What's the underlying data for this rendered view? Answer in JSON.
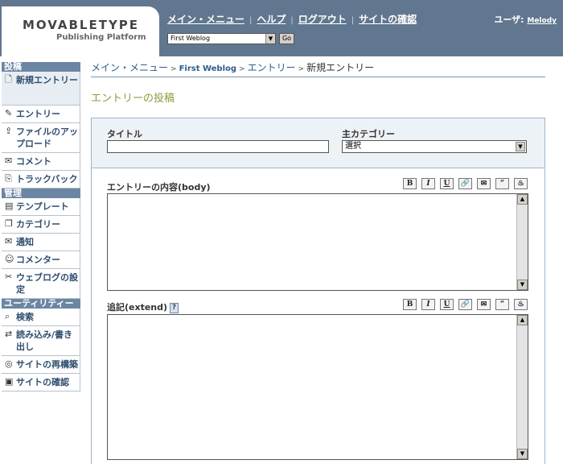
{
  "logo": {
    "title": "MOVABLETYPE",
    "subtitle": "Publishing Platform"
  },
  "topnav": {
    "main_menu": "メイン・メニュー",
    "help": "ヘルプ",
    "logout": "ログアウト",
    "view_site": "サイトの確認"
  },
  "user": {
    "label": "ユーザ:",
    "name": "Melody"
  },
  "blog_selector": {
    "selected": "First Weblog",
    "go_label": "Go"
  },
  "sidebar": {
    "sections": [
      {
        "title": "投稿",
        "items": [
          {
            "label": "新規エントリー",
            "icon": "new-entry-icon"
          },
          {
            "label": "エントリー",
            "icon": "entries-icon"
          },
          {
            "label": "ファイルのアップロード",
            "icon": "upload-icon"
          },
          {
            "label": "コメント",
            "icon": "comment-icon"
          },
          {
            "label": "トラックバック",
            "icon": "trackback-icon"
          }
        ]
      },
      {
        "title": "管理",
        "items": [
          {
            "label": "テンプレート",
            "icon": "template-icon"
          },
          {
            "label": "カテゴリー",
            "icon": "category-icon"
          },
          {
            "label": "通知",
            "icon": "notification-icon"
          },
          {
            "label": "コメンター",
            "icon": "commenter-icon"
          },
          {
            "label": "ウェブログの設定",
            "icon": "settings-icon"
          }
        ]
      },
      {
        "title": "ユーティリティー",
        "items": [
          {
            "label": "検索",
            "icon": "search-icon"
          },
          {
            "label": "読み込み/書き出し",
            "icon": "import-export-icon"
          },
          {
            "label": "サイトの再構築",
            "icon": "rebuild-icon"
          },
          {
            "label": "サイトの確認",
            "icon": "view-site-icon"
          }
        ]
      }
    ]
  },
  "breadcrumb": {
    "main_menu": "メイン・メニュー",
    "blog": "First Weblog",
    "entries": "エントリー",
    "current": "新規エントリー"
  },
  "page_title": "エントリーの投稿",
  "form": {
    "title_label": "タイトル",
    "title_value": "",
    "category_label": "主カテゴリー",
    "category_selected": "選択",
    "body_label": "エントリーの内容(body)",
    "extend_label": "追記(extend)",
    "help_label": "?",
    "toolbar": [
      "B",
      "I",
      "U",
      "🔗",
      "✉",
      "“",
      "♨"
    ]
  },
  "colors": {
    "header": "#61778f",
    "accent": "#6b86a3",
    "title": "#8a9c3a"
  }
}
